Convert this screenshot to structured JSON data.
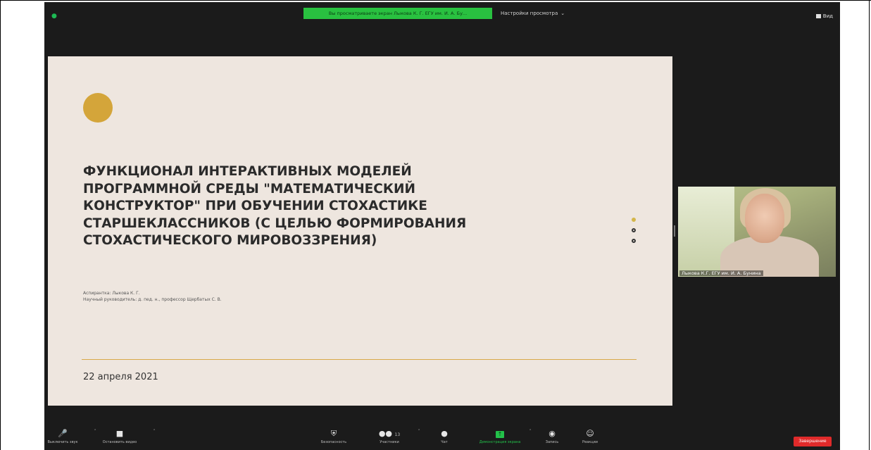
{
  "topbar": {
    "banner": "Вы просматриваете экран Лыкова К. Г. ЕГУ им. И. А. Бу...",
    "view_options": "Настройки просмотра",
    "view_button": "Вид"
  },
  "slide": {
    "title_lines": [
      "ФУНКЦИОНАЛ ИНТЕРАКТИВНЫХ МОДЕЛЕЙ",
      "ПРОГРАММНОЙ СРЕДЫ \"МАТЕМАТИЧЕСКИЙ",
      "КОНСТРУКТОР\" ПРИ ОБУЧЕНИИ СТОХАСТИКЕ",
      "СТАРШЕКЛАССНИКОВ (С ЦЕЛЬЮ ФОРМИРОВАНИЯ",
      "СТОХАСТИЧЕСКОГО МИРОВОЗЗРЕНИЯ)"
    ],
    "author": "Аспирантка: Лыкова К. Г.",
    "supervisor": "Научный руководитель: д. пед. н., профессор Щербатых С. В.",
    "date": "22 апреля 2021",
    "accent_color": "#d4a53a"
  },
  "participant": {
    "name": "Лыкова К.Г. ЕГУ им. И. А. Бунина"
  },
  "toolbar": {
    "mute": "Выключить звук",
    "stop_video": "Остановить видео",
    "security": "Безопасность",
    "participants": "Участники",
    "participants_count": "13",
    "chat": "Чат",
    "share_screen": "Демонстрация экрана",
    "record": "Запись",
    "reactions": "Реакции",
    "end": "Завершение"
  }
}
